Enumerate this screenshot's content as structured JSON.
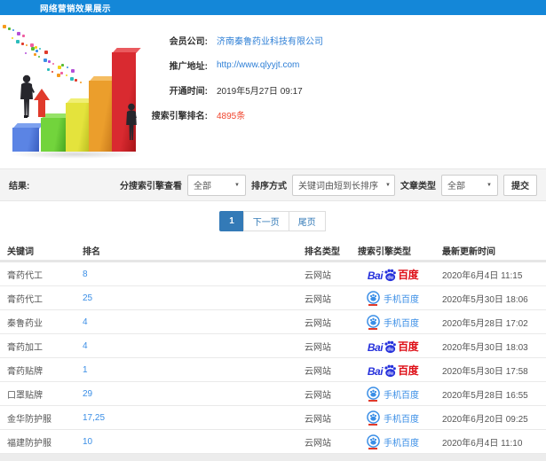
{
  "header": {
    "title": "网络营销效果展示",
    "bg_color": "#1487d8"
  },
  "info": {
    "rows": [
      {
        "label": "会员公司:",
        "value": "济南秦鲁药业科技有限公司",
        "type": "link"
      },
      {
        "label": "推广地址:",
        "value": "http://www.qlyyjt.com",
        "type": "link"
      },
      {
        "label": "开通时间:",
        "value": "2019年5月27日 09:17",
        "type": "text"
      },
      {
        "label": "搜索引擎排名:",
        "value": "4895条",
        "type": "highlight"
      }
    ]
  },
  "filters": {
    "result_label": "结果:",
    "engine_label": "分搜索引擎查看",
    "engine_value": "全部",
    "sort_label": "排序方式",
    "sort_value": "关键词由短到长排序",
    "article_label": "文章类型",
    "article_value": "全部",
    "submit_label": "提交",
    "caret": "▼"
  },
  "pagination": {
    "current": "1",
    "next_label": "下一页",
    "last_label": "尾页"
  },
  "table": {
    "headers": [
      "关键词",
      "排名",
      "排名类型",
      "搜索引擎类型",
      "最新更新时间"
    ],
    "rows": [
      {
        "keyword": "膏药代工",
        "rank": "8",
        "rank_type": "云网站",
        "engine": "baidu-pc",
        "updated": "2020年6月4日 11:15"
      },
      {
        "keyword": "膏药代工",
        "rank": "25",
        "rank_type": "云网站",
        "engine": "baidu-mobile",
        "updated": "2020年5月30日 18:06"
      },
      {
        "keyword": "秦鲁药业",
        "rank": "4",
        "rank_type": "云网站",
        "engine": "baidu-mobile",
        "updated": "2020年5月28日 17:02"
      },
      {
        "keyword": "膏药加工",
        "rank": "4",
        "rank_type": "云网站",
        "engine": "baidu-pc",
        "updated": "2020年5月30日 18:03"
      },
      {
        "keyword": "膏药贴牌",
        "rank": "1",
        "rank_type": "云网站",
        "engine": "baidu-pc",
        "updated": "2020年5月30日 17:58"
      },
      {
        "keyword": "口罩贴牌",
        "rank": "29",
        "rank_type": "云网站",
        "engine": "baidu-mobile",
        "updated": "2020年5月28日 16:55"
      },
      {
        "keyword": "金华防护服",
        "rank": "17,25",
        "rank_type": "云网站",
        "engine": "baidu-mobile",
        "updated": "2020年6月20日 09:25"
      },
      {
        "keyword": "福建防护服",
        "rank": "10",
        "rank_type": "云网站",
        "engine": "baidu-mobile",
        "updated": "2020年6月4日 11:10"
      }
    ]
  },
  "engine_logos": {
    "baidu_pc": {
      "prefix": "Bai",
      "suffix": "百度",
      "blue": "#2732dc",
      "red": "#de0f17"
    },
    "baidu_mobile": {
      "label": "手机百度",
      "color": "#3a8ee6",
      "underline_color": "#e03a2b"
    }
  },
  "hero_image": {
    "description": "3D rising bar chart with two businessman figures, red growth arrow and confetti",
    "bar_colors": [
      "#5b84e4",
      "#72d43c",
      "#e4e33c",
      "#eb9e2c",
      "#d92a30"
    ],
    "arrow_color": "#e03a2b"
  },
  "colors": {
    "header_blue": "#1487d8",
    "link_blue": "#2e7fd6",
    "rank_blue": "#3a8ee6",
    "alert_red": "#f0442c",
    "active_page": "#337ab7",
    "filter_bar_bg": "#f4f4f4"
  }
}
